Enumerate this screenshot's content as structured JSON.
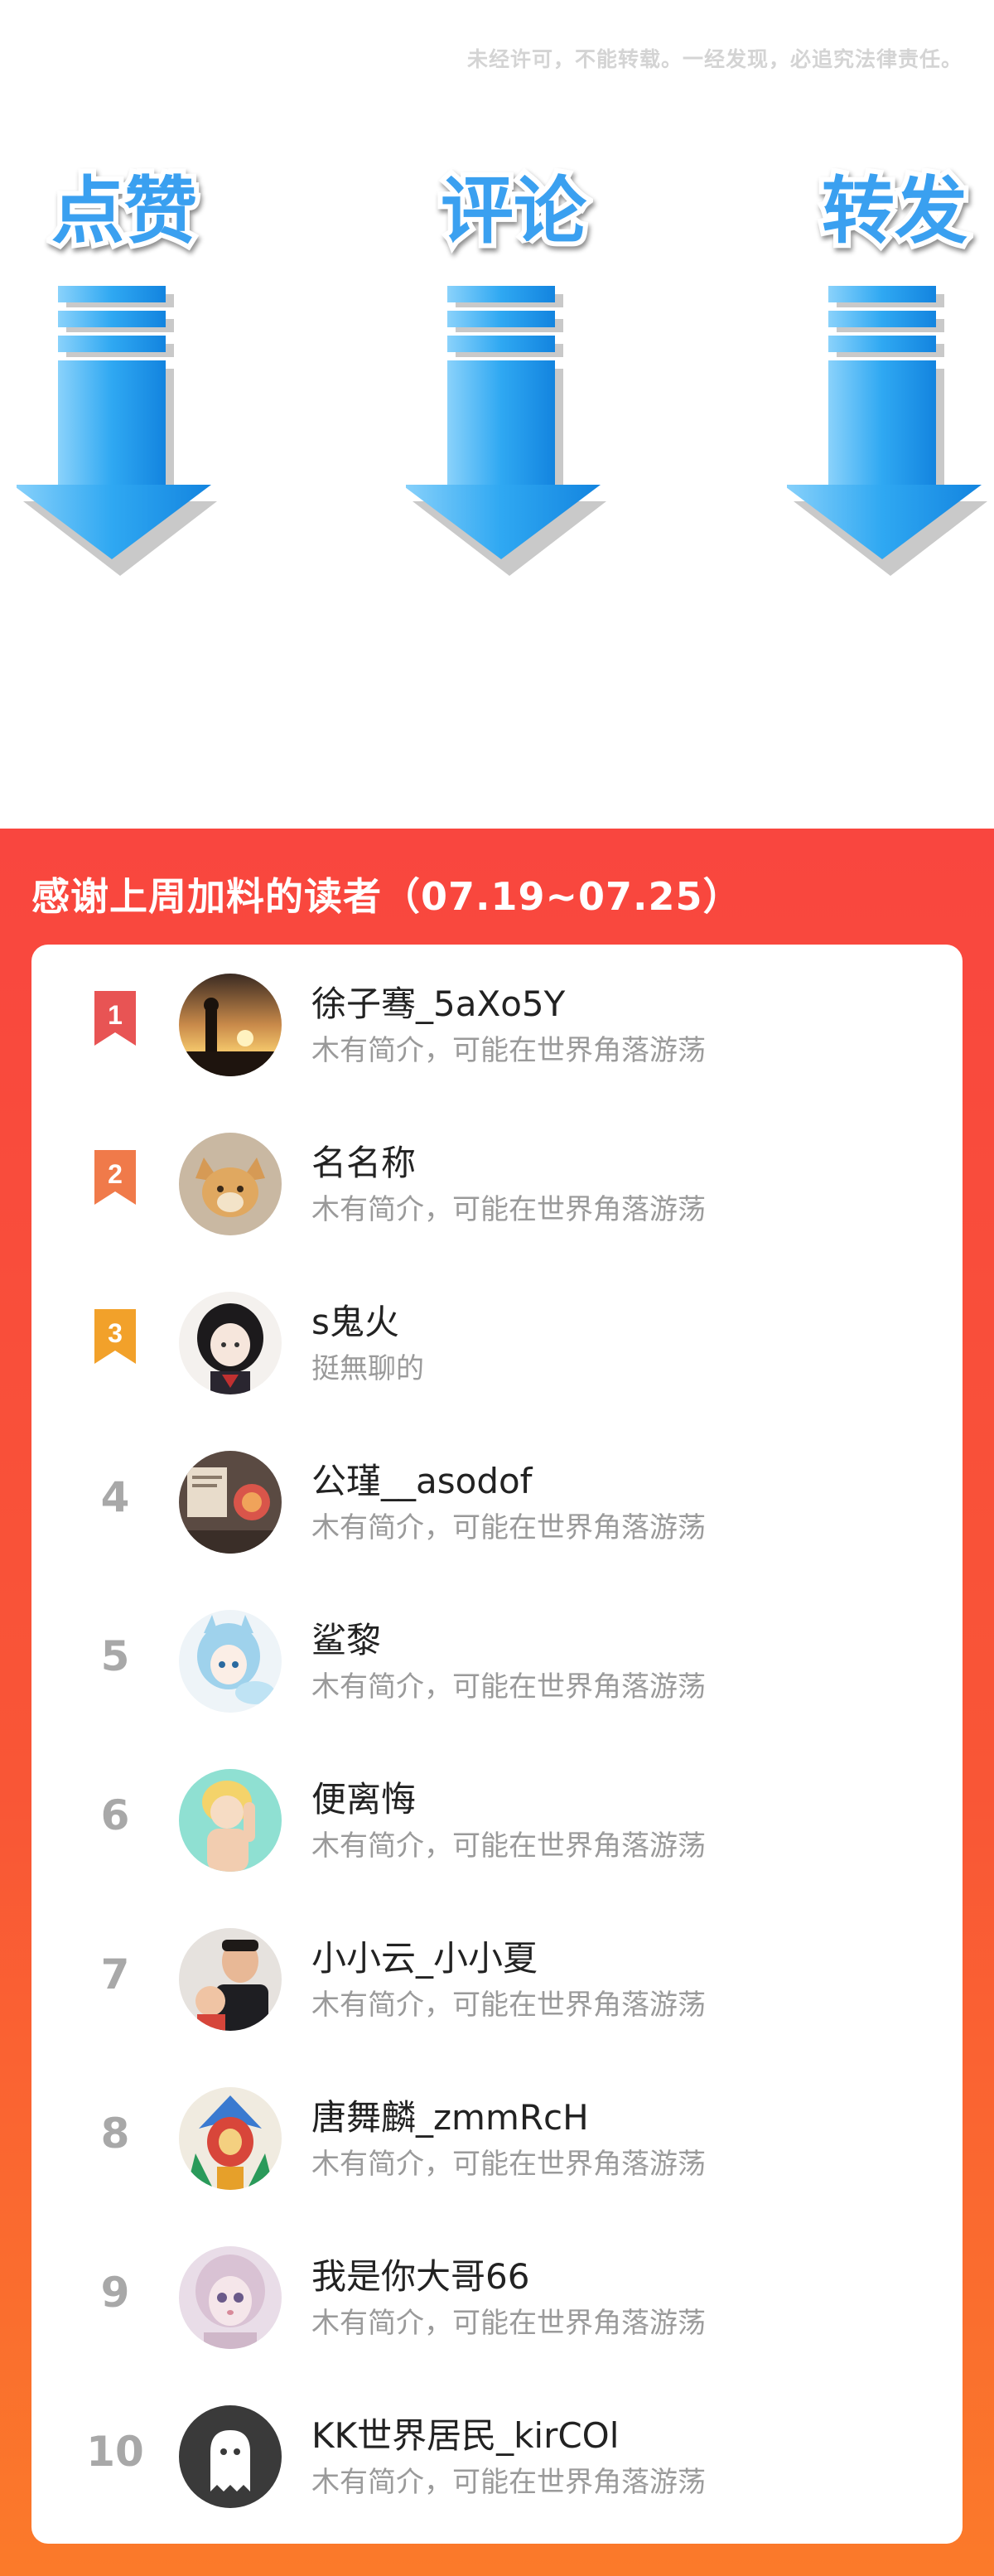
{
  "notice": "未经许可，不能转载。一经发现，必追究法律责任。",
  "actions": [
    {
      "label": "点赞",
      "icon": "down-arrow-icon"
    },
    {
      "label": "评论",
      "icon": "down-arrow-icon"
    },
    {
      "label": "转发",
      "icon": "down-arrow-icon"
    }
  ],
  "panel": {
    "title": "感谢上周加料的读者（07.19~07.25）",
    "readers": [
      {
        "rank": "1",
        "name": "徐子骞_5aXo5Y",
        "bio": "木有简介，可能在世界角落游荡",
        "avatar": "sunset-silhouette-avatar"
      },
      {
        "rank": "2",
        "name": "名名称",
        "bio": "木有简介，可能在世界角落游荡",
        "avatar": "cartoon-fox-avatar"
      },
      {
        "rank": "3",
        "name": "s鬼火",
        "bio": "挺無聊的",
        "avatar": "anime-girl-avatar"
      },
      {
        "rank": "4",
        "name": "公瑾__asodof",
        "bio": "木有简介，可能在世界角落游荡",
        "avatar": "room-photo-avatar"
      },
      {
        "rank": "5",
        "name": "鲨黎",
        "bio": "木有简介，可能在世界角落游荡",
        "avatar": "anime-bluehair-avatar"
      },
      {
        "rank": "6",
        "name": "便离悔",
        "bio": "木有简介，可能在世界角落游荡",
        "avatar": "anime-blonde-avatar"
      },
      {
        "rank": "7",
        "name": "小小云_小小夏",
        "bio": "木有简介，可能在世界角落游荡",
        "avatar": "father-child-avatar"
      },
      {
        "rank": "8",
        "name": "唐舞麟_zmmRcH",
        "bio": "木有简介，可能在世界角落游荡",
        "avatar": "colorful-character-avatar"
      },
      {
        "rank": "9",
        "name": "我是你大哥66",
        "bio": "木有简介，可能在世界角落游荡",
        "avatar": "doll-avatar"
      },
      {
        "rank": "10",
        "name": "KK世界居民_kirCOl",
        "bio": "木有简介，可能在世界角落游荡",
        "avatar": "default-ghost-avatar"
      }
    ]
  },
  "colors": {
    "rank1": "#e85454",
    "rank2": "#f07a4a",
    "rank3": "#f2a12a",
    "panel_top": "#f9463f",
    "panel_bottom": "#fb7a2a",
    "arrow": "#1e9cf0"
  }
}
